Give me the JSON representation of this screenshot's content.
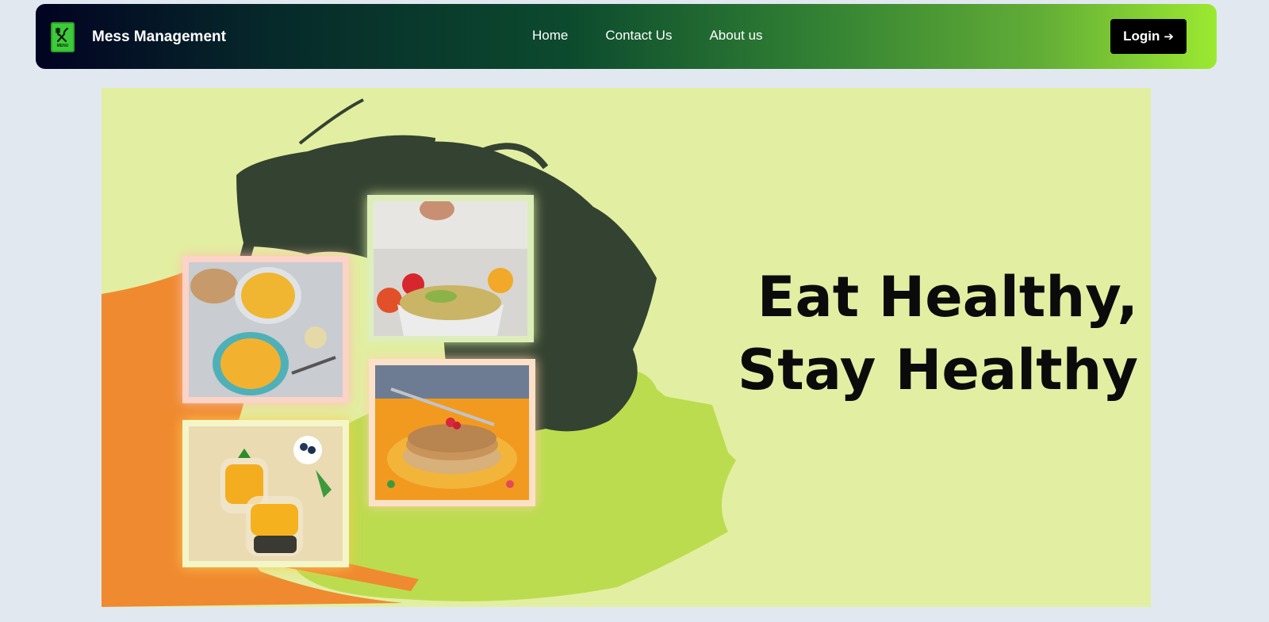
{
  "header": {
    "brand": "Mess Management",
    "logo_icon": "menu-book-icon",
    "logo_caption": "MENU",
    "nav": [
      "Home",
      "Contact Us",
      "About us"
    ],
    "login_label": "Login",
    "login_icon": "arrow-right-icon"
  },
  "hero": {
    "line1": "Eat Healthy,",
    "line2": "Stay Healthy",
    "photos": [
      "soup-bowls-photo",
      "salad-bowl-photo",
      "pancake-stack-photo",
      "mango-parfait-photo"
    ]
  },
  "colors": {
    "page_bg": "#e2e8f0",
    "hero_bg": "#e2efa2",
    "nav_gradient_start": "#020322",
    "nav_gradient_end": "#9ce931",
    "splash_dark": "#344231",
    "splash_orange": "#ef8a30",
    "splash_lime": "#bcdc4f",
    "login_bg": "#000000"
  }
}
